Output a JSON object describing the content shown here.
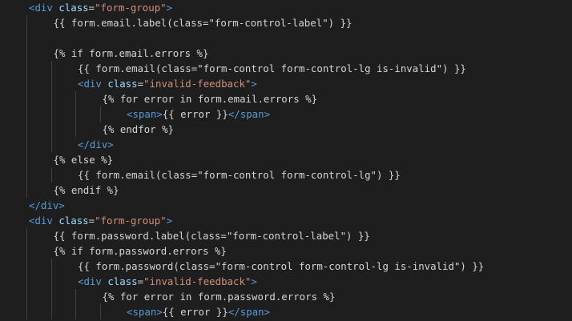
{
  "editor": {
    "background": "#1e1e1e",
    "colors": {
      "tag": "#569cd6",
      "attr": "#9cdcfe",
      "str": "#ce9178",
      "txt": "#d4d4d4",
      "punct": "#808080"
    },
    "lines": [
      {
        "indent": 4,
        "tokens": [
          {
            "t": "tag",
            "v": "<div"
          },
          {
            "t": "txt",
            "v": " "
          },
          {
            "t": "attr",
            "v": "class"
          },
          {
            "t": "txt",
            "v": "="
          },
          {
            "t": "str",
            "v": "\"form-group\""
          },
          {
            "t": "tag",
            "v": ">"
          }
        ]
      },
      {
        "indent": 5,
        "tokens": [
          {
            "t": "txt",
            "v": "{{ form.email.label(class=\"form-control-label\") }}"
          }
        ]
      },
      {
        "indent": 5,
        "tokens": []
      },
      {
        "indent": 5,
        "tokens": [
          {
            "t": "txt",
            "v": "{% if form.email.errors %}"
          }
        ]
      },
      {
        "indent": 6,
        "tokens": [
          {
            "t": "txt",
            "v": "{{ form.email(class=\"form-control form-control-lg is-invalid\") }}"
          }
        ]
      },
      {
        "indent": 6,
        "tokens": [
          {
            "t": "tag",
            "v": "<div"
          },
          {
            "t": "txt",
            "v": " "
          },
          {
            "t": "attr",
            "v": "class"
          },
          {
            "t": "txt",
            "v": "="
          },
          {
            "t": "str",
            "v": "\"invalid-feedback\""
          },
          {
            "t": "tag",
            "v": ">"
          }
        ]
      },
      {
        "indent": 7,
        "tokens": [
          {
            "t": "txt",
            "v": "{% for error in form.email.errors %}"
          }
        ]
      },
      {
        "indent": 8,
        "tokens": [
          {
            "t": "tag",
            "v": "<span>"
          },
          {
            "t": "txt",
            "v": "{{ error }}"
          },
          {
            "t": "tag",
            "v": "</span>"
          }
        ]
      },
      {
        "indent": 7,
        "tokens": [
          {
            "t": "txt",
            "v": "{% endfor %}"
          }
        ]
      },
      {
        "indent": 6,
        "tokens": [
          {
            "t": "tag",
            "v": "</div>"
          }
        ]
      },
      {
        "indent": 5,
        "tokens": [
          {
            "t": "txt",
            "v": "{% else %}"
          }
        ]
      },
      {
        "indent": 6,
        "tokens": [
          {
            "t": "txt",
            "v": "{{ form.email(class=\"form-control form-control-lg\") }}"
          }
        ]
      },
      {
        "indent": 5,
        "tokens": [
          {
            "t": "txt",
            "v": "{% endif %}"
          }
        ]
      },
      {
        "indent": 4,
        "tokens": [
          {
            "t": "tag",
            "v": "</div>"
          }
        ]
      },
      {
        "indent": 4,
        "tokens": [
          {
            "t": "tag",
            "v": "<div"
          },
          {
            "t": "txt",
            "v": " "
          },
          {
            "t": "attr",
            "v": "class"
          },
          {
            "t": "txt",
            "v": "="
          },
          {
            "t": "str",
            "v": "\"form-group\""
          },
          {
            "t": "tag",
            "v": ">"
          }
        ]
      },
      {
        "indent": 5,
        "tokens": [
          {
            "t": "txt",
            "v": "{{ form.password.label(class=\"form-control-label\") }}"
          }
        ]
      },
      {
        "indent": 5,
        "tokens": [
          {
            "t": "txt",
            "v": "{% if form.password.errors %}"
          }
        ]
      },
      {
        "indent": 6,
        "tokens": [
          {
            "t": "txt",
            "v": "{{ form.password(class=\"form-control form-control-lg is-invalid\") }}"
          }
        ]
      },
      {
        "indent": 6,
        "tokens": [
          {
            "t": "tag",
            "v": "<div"
          },
          {
            "t": "txt",
            "v": " "
          },
          {
            "t": "attr",
            "v": "class"
          },
          {
            "t": "txt",
            "v": "="
          },
          {
            "t": "str",
            "v": "\"invalid-feedback\""
          },
          {
            "t": "tag",
            "v": ">"
          }
        ]
      },
      {
        "indent": 7,
        "tokens": [
          {
            "t": "txt",
            "v": "{% for error in form.password.errors %}"
          }
        ]
      },
      {
        "indent": 8,
        "tokens": [
          {
            "t": "tag",
            "v": "<span>"
          },
          {
            "t": "txt",
            "v": "{{ error }}"
          },
          {
            "t": "tag",
            "v": "</span>"
          }
        ]
      }
    ]
  }
}
